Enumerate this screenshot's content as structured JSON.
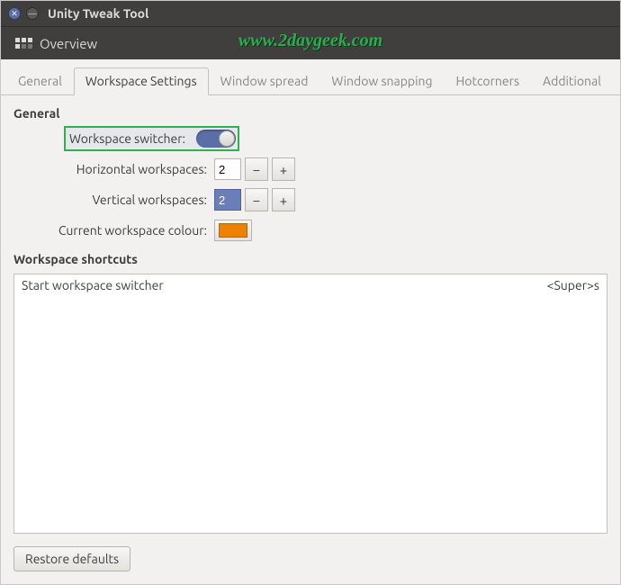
{
  "window": {
    "title": "Unity Tweak Tool"
  },
  "watermark": "www.2daygeek.com",
  "overview_label": "Overview",
  "tabs": [
    {
      "label": "General"
    },
    {
      "label": "Workspace Settings"
    },
    {
      "label": "Window spread"
    },
    {
      "label": "Window snapping"
    },
    {
      "label": "Hotcorners"
    },
    {
      "label": "Additional"
    }
  ],
  "active_tab_index": 1,
  "sections": {
    "general": "General",
    "shortcuts": "Workspace shortcuts"
  },
  "fields": {
    "switcher_label": "Workspace switcher:",
    "switcher_on": true,
    "horiz_label": "Horizontal workspaces:",
    "horiz_value": "2",
    "vert_label": "Vertical workspaces:",
    "vert_value": "2",
    "colour_label": "Current workspace colour:",
    "colour_value": "#f08000"
  },
  "shortcuts": [
    {
      "name": "Start workspace switcher",
      "accel": "<Super>s"
    }
  ],
  "restore_label": "Restore defaults"
}
